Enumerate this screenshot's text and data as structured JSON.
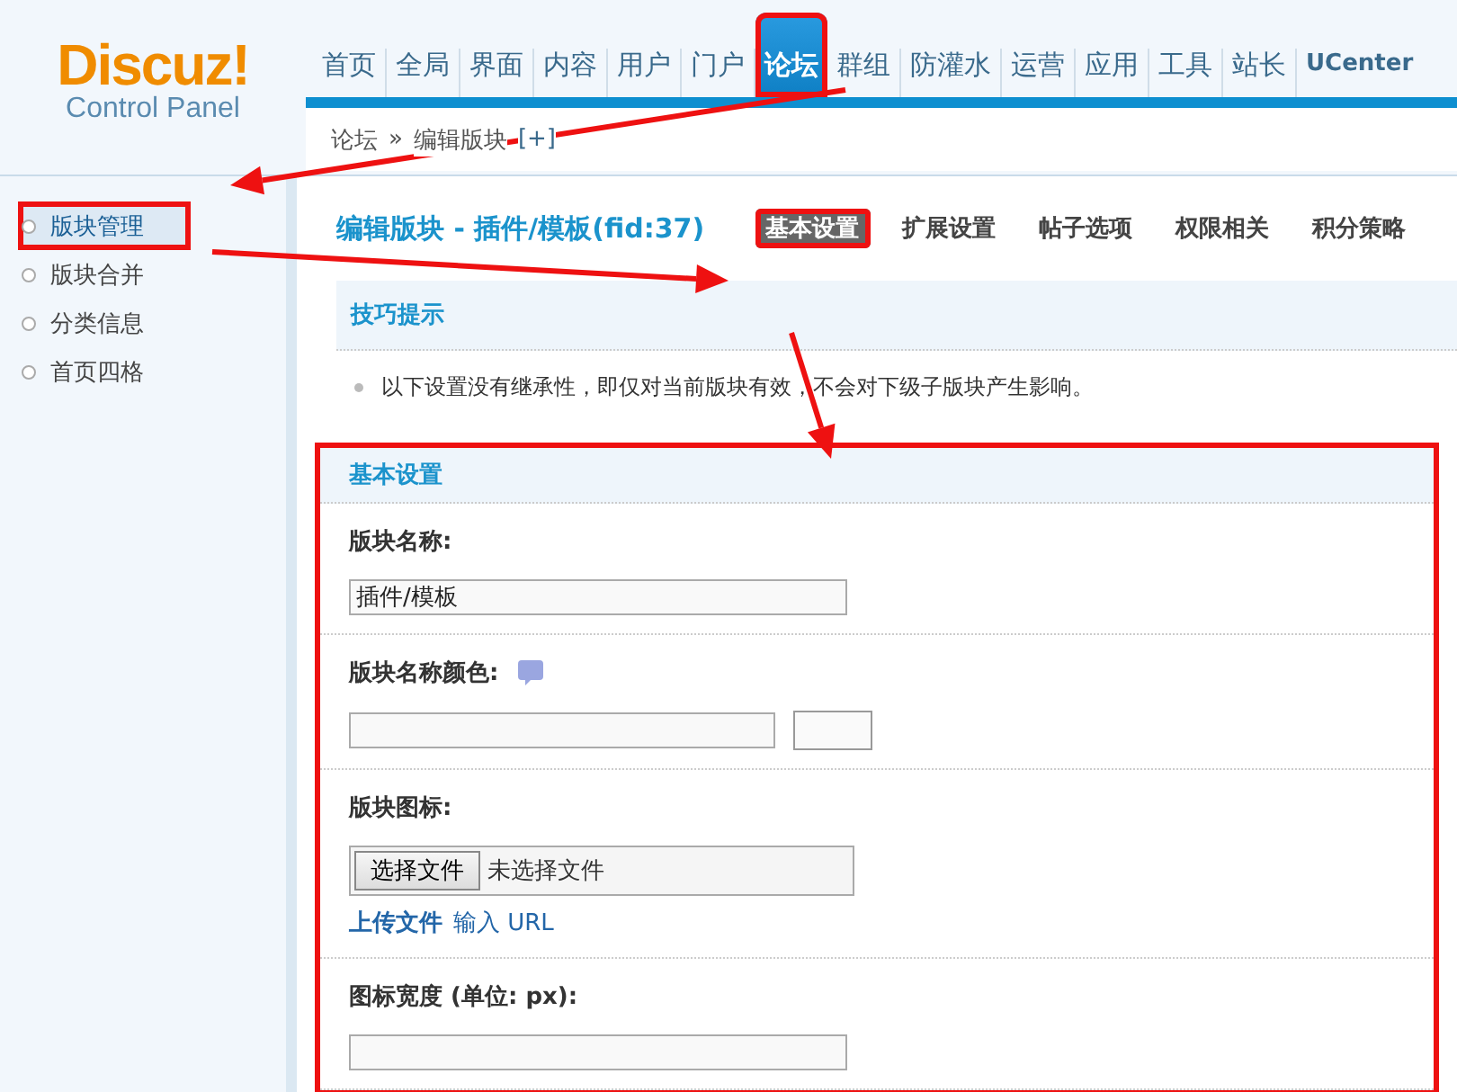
{
  "logo": {
    "name": "Discuz!",
    "subtitle": "Control Panel"
  },
  "nav": [
    {
      "label": "首页",
      "selected": false,
      "highlighted": false
    },
    {
      "label": "全局",
      "selected": false,
      "highlighted": false
    },
    {
      "label": "界面",
      "selected": false,
      "highlighted": false
    },
    {
      "label": "内容",
      "selected": false,
      "highlighted": false
    },
    {
      "label": "用户",
      "selected": false,
      "highlighted": false
    },
    {
      "label": "门户",
      "selected": false,
      "highlighted": false
    },
    {
      "label": "论坛",
      "selected": true,
      "highlighted": true
    },
    {
      "label": "群组",
      "selected": false,
      "highlighted": false
    },
    {
      "label": "防灌水",
      "selected": false,
      "highlighted": false
    },
    {
      "label": "运营",
      "selected": false,
      "highlighted": false
    },
    {
      "label": "应用",
      "selected": false,
      "highlighted": false
    },
    {
      "label": "工具",
      "selected": false,
      "highlighted": false
    },
    {
      "label": "站长",
      "selected": false,
      "highlighted": false
    },
    {
      "label": "UCenter",
      "selected": false,
      "highlighted": false
    }
  ],
  "breadcrumb": {
    "items": [
      "论坛",
      "编辑版块"
    ],
    "separator": "»",
    "add": "[+]"
  },
  "sidebar": [
    {
      "label": "版块管理",
      "selected": true,
      "highlighted": true
    },
    {
      "label": "版块合并",
      "selected": false,
      "highlighted": false
    },
    {
      "label": "分类信息",
      "selected": false,
      "highlighted": false
    },
    {
      "label": "首页四格",
      "selected": false,
      "highlighted": false
    }
  ],
  "page_title": "编辑版块 - 插件/模板(fid:37)",
  "tabs": [
    {
      "label": "基本设置",
      "selected": true,
      "highlighted": true
    },
    {
      "label": "扩展设置",
      "selected": false,
      "highlighted": false
    },
    {
      "label": "帖子选项",
      "selected": false,
      "highlighted": false
    },
    {
      "label": "权限相关",
      "selected": false,
      "highlighted": false
    },
    {
      "label": "积分策略",
      "selected": false,
      "highlighted": false
    }
  ],
  "tips": {
    "title": "技巧提示",
    "items": [
      "以下设置没有继承性，即仅对当前版块有效，不会对下级子版块产生影响。"
    ]
  },
  "section": {
    "title": "基本设置",
    "highlighted": true,
    "fields": [
      {
        "kind": "text",
        "label": "版块名称:",
        "value": "插件/模板"
      },
      {
        "kind": "color",
        "label": "版块名称颜色:",
        "help": true
      },
      {
        "kind": "file",
        "label": "版块图标:",
        "button": "选择文件",
        "status": "未选择文件",
        "links": [
          {
            "label": "上传文件",
            "selected": true
          },
          {
            "label": "输入 URL",
            "selected": false
          }
        ]
      },
      {
        "kind": "text",
        "label": "图标宽度 (单位: px):"
      }
    ]
  }
}
